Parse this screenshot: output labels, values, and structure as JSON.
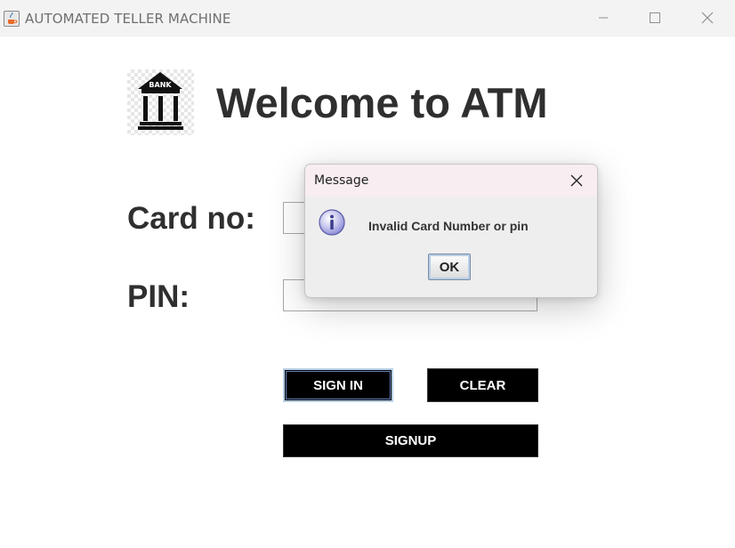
{
  "window": {
    "title": "AUTOMATED TELLER MACHINE",
    "icon": "java-cup-icon",
    "controls": [
      "minimize-icon",
      "maximize-icon",
      "close-icon"
    ]
  },
  "main": {
    "logo_icon": "bank-building-icon",
    "logo_text": "BANK",
    "heading": "Welcome to ATM",
    "card_label": "Card no:",
    "card_value": "",
    "pin_label": "PIN:",
    "pin_value": "",
    "buttons": {
      "sign_in": "SIGN IN",
      "clear": "CLEAR",
      "signup": "SIGNUP"
    }
  },
  "dialog": {
    "title": "Message",
    "icon": "info-icon",
    "message": "Invalid Card Number or pin",
    "ok_label": "OK"
  },
  "colors": {
    "window_background": "#ffffff",
    "titlebar_background": "#f3f3f3",
    "button_background": "#000000",
    "button_text": "#ffffff",
    "heading_text": "#2f2f2f",
    "dialog_background": "#eeeeee",
    "dialog_titlebar_background": "#f8edf0",
    "focus_ring": "#b8cfe5"
  }
}
